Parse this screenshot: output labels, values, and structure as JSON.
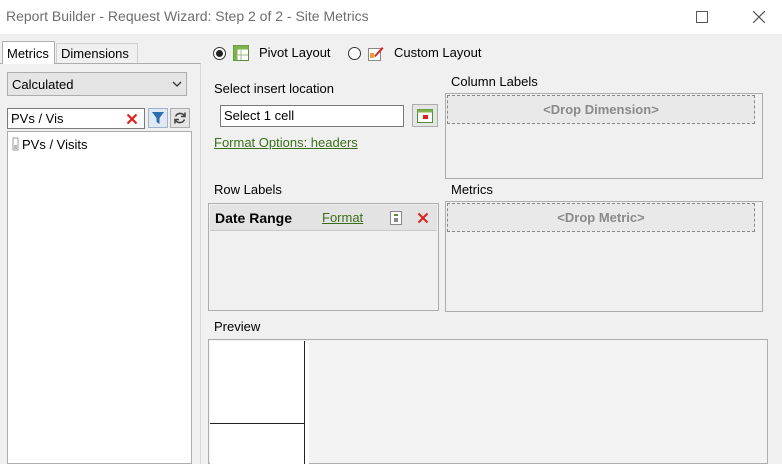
{
  "window": {
    "title": "Report Builder - Request Wizard: Step 2 of 2 - Site Metrics"
  },
  "left": {
    "tabs": [
      {
        "label": "Metrics",
        "active": true
      },
      {
        "label": "Dimensions",
        "active": false
      }
    ],
    "category_select": {
      "value": "Calculated"
    },
    "search": {
      "value": "PVs / Vis"
    },
    "metrics": [
      {
        "label": "PVs / Visits"
      }
    ]
  },
  "layout": {
    "pivot_label": "Pivot Layout",
    "pivot_selected": true,
    "custom_label": "Custom Layout",
    "custom_selected": false
  },
  "insert": {
    "label": "Select insert location",
    "value": "Select 1 cell",
    "format_link": "Format Options: headers"
  },
  "columns": {
    "label": "Column Labels",
    "drop_text": "<Drop Dimension>"
  },
  "rows": {
    "label": "Row Labels",
    "items": [
      {
        "name": "Date Range",
        "format_link": "Format"
      }
    ]
  },
  "metrics_zone": {
    "label": "Metrics",
    "drop_text": "<Drop Metric>"
  },
  "preview": {
    "label": "Preview"
  },
  "colors": {
    "link": "#3a6e1b",
    "delete": "#d9241c",
    "filter": "#2b6cb0"
  }
}
